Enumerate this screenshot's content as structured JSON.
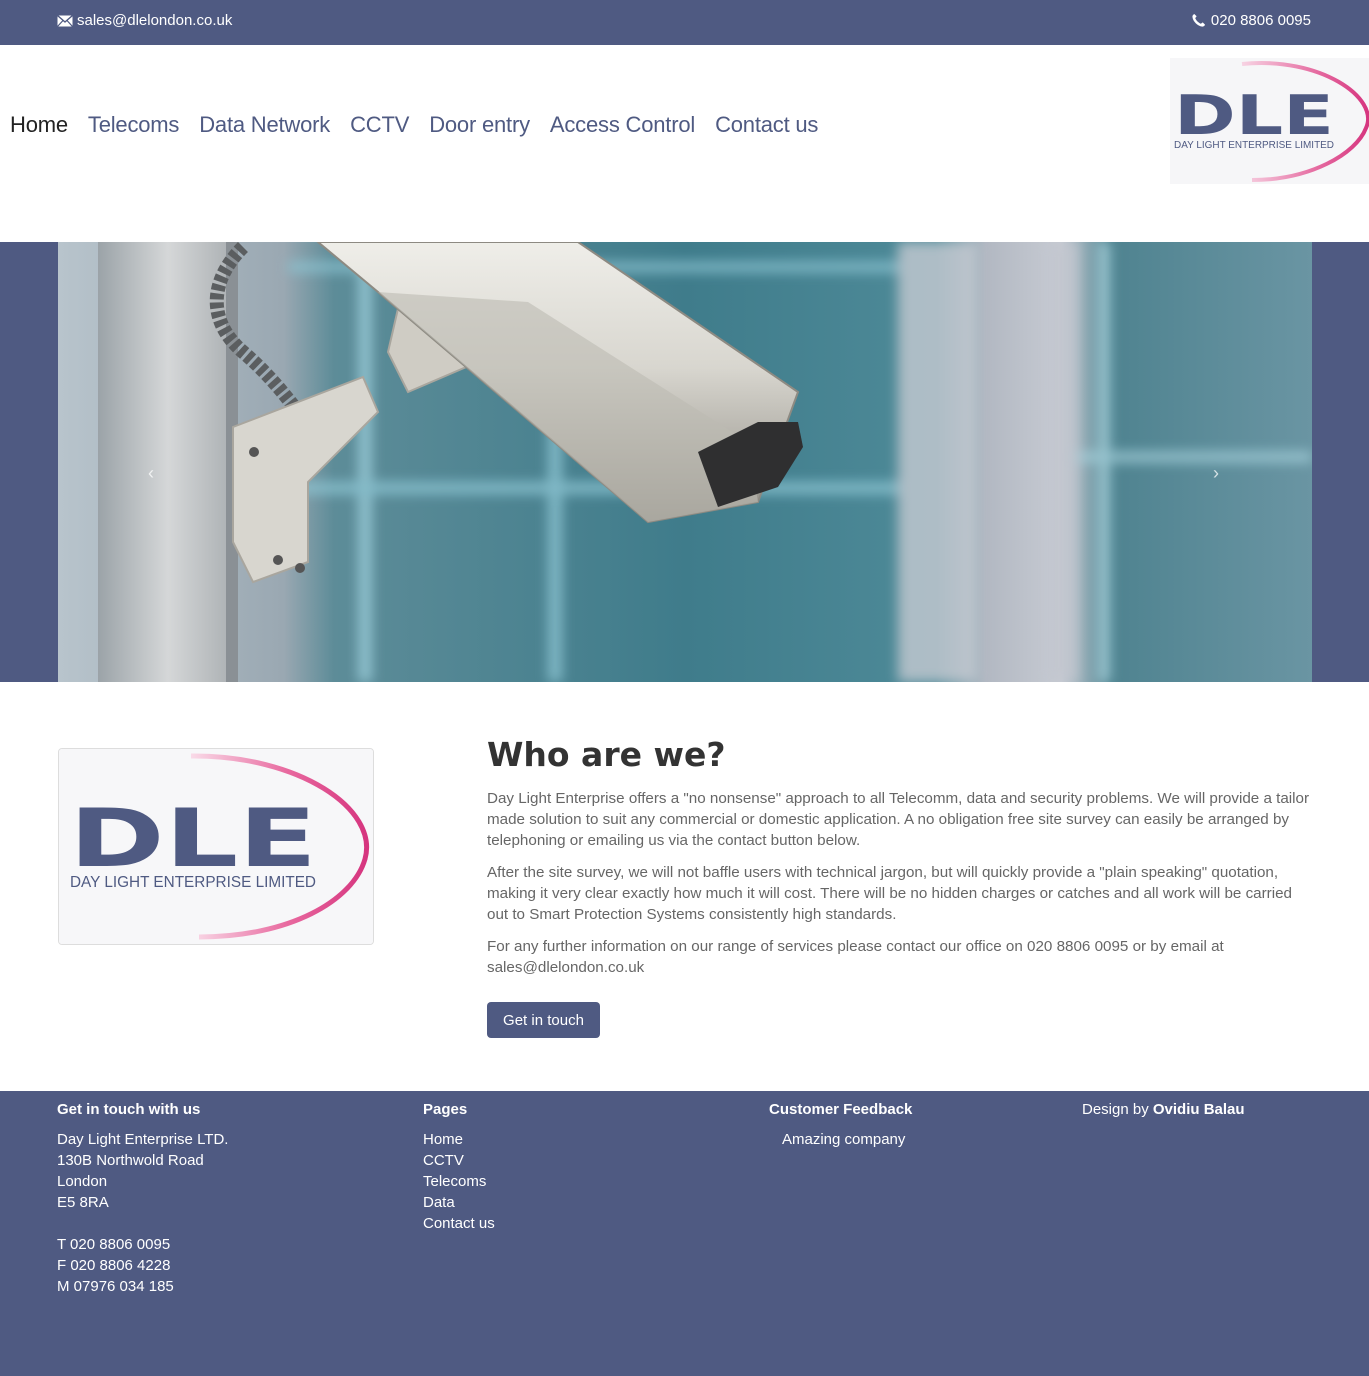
{
  "topbar": {
    "email": "sales@dlelondon.co.uk",
    "phone": "020 8806 0095"
  },
  "nav": {
    "items": [
      "Home",
      "Telecoms",
      "Data Network",
      "CCTV",
      "Door entry",
      "Access Control",
      "Contact us"
    ]
  },
  "logo": {
    "letters": "DLE",
    "tagline": "DAY LIGHT ENTERPRISE LIMITED"
  },
  "hero": {
    "prev": "‹",
    "next": "›"
  },
  "about": {
    "heading": "Who are we?",
    "p1": "Day Light Enterprise offers a \"no nonsense\" approach to all Telecomm, data and security problems. We will provide a tailor made solution to suit any commercial or domestic application. A no obligation free site survey can easily be arranged by telephoning or emailing us via the contact button below.",
    "p2": "After the site survey, we will not baffle users with technical jargon, but will quickly provide a \"plain speaking\" quotation, making it very clear exactly how much it will cost. There will be no hidden charges or catches and all work will be carried out to Smart Protection Systems consistently high standards.",
    "p3": "For any further information on our range of services please contact our office on 020 8806 0095 or by email at sales@dlelondon.co.uk",
    "button": "Get in touch"
  },
  "footer": {
    "contact": {
      "heading": "Get in touch with us",
      "company": "Day Light Enterprise LTD.",
      "address1": "130B Northwold Road",
      "city": "London",
      "postcode": "E5 8RA",
      "tel": "T 020 8806 0095",
      "fax": "F 020 8806 4228",
      "mobile": "M 07976 034 185"
    },
    "pages": {
      "heading": "Pages",
      "links": [
        "Home",
        "CCTV",
        "Telecoms",
        "Data",
        "Contact us"
      ]
    },
    "feedback": {
      "heading": "Customer Feedback",
      "quote": "Amazing company"
    },
    "credit": {
      "prefix": "Design by",
      "author": "Ovidiu Balau"
    }
  },
  "colors": {
    "brand": "#4f5a82",
    "accent_pink": "#d6357f"
  }
}
